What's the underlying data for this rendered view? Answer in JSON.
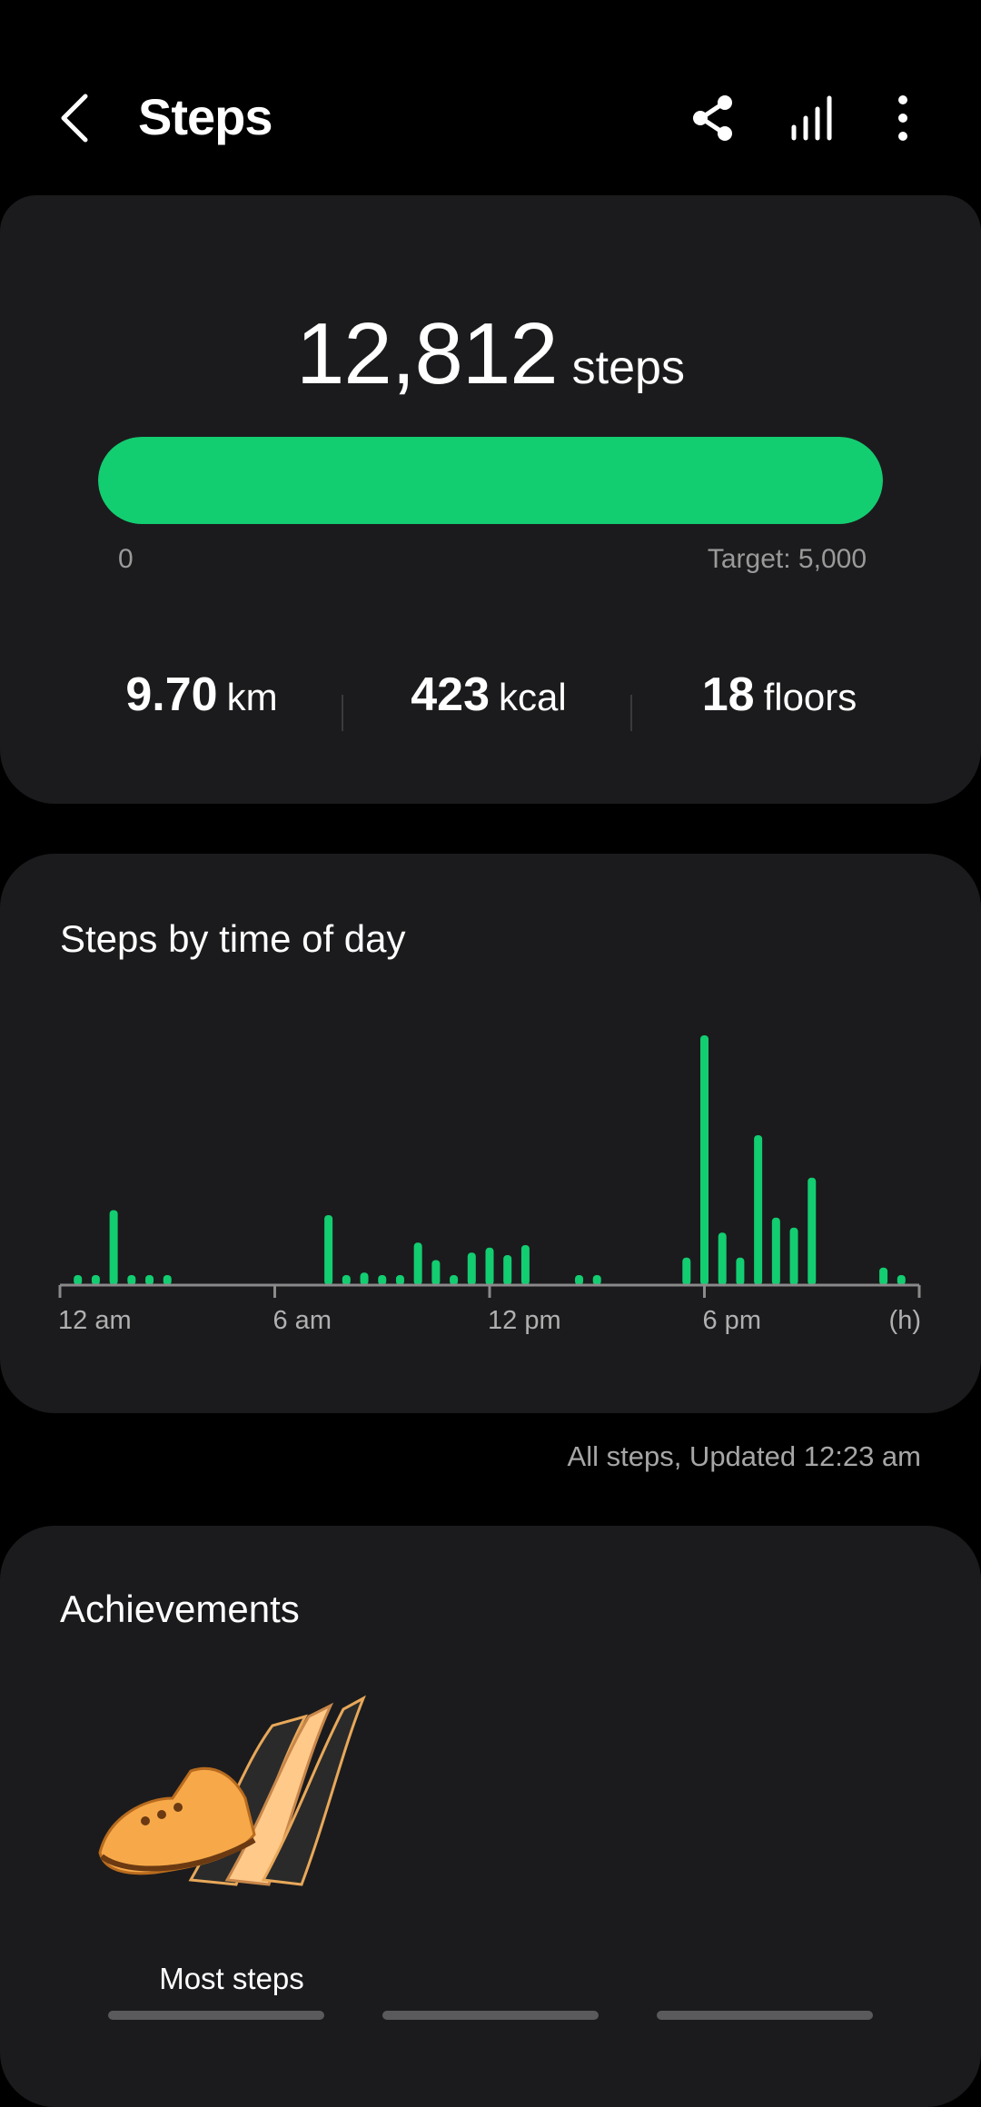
{
  "header": {
    "title": "Steps",
    "icons": [
      "chevron-left-icon",
      "share-icon",
      "trends-icon",
      "more-vert-icon"
    ]
  },
  "summary": {
    "steps": "12,812",
    "steps_unit": "steps",
    "progress": {
      "min_label": "0",
      "target_label": "Target: 5,000",
      "fill_fraction": 1.0
    },
    "metrics": [
      {
        "value": "9.70",
        "unit": "km"
      },
      {
        "value": "423",
        "unit": "kcal"
      },
      {
        "value": "18",
        "unit": "floors"
      }
    ]
  },
  "chart": {
    "title": "Steps by time of day",
    "footer": "All steps, Updated 12:23 am"
  },
  "chart_data": {
    "type": "bar",
    "xlabel": "",
    "ylabel": "",
    "x_ticks": [
      "12 am",
      "6 am",
      "12 pm",
      "6 pm",
      "(h)"
    ],
    "x": [
      0.5,
      1.0,
      1.5,
      2.0,
      2.5,
      3.0,
      7.5,
      8.0,
      8.5,
      9.0,
      9.5,
      10.0,
      10.5,
      11.0,
      11.5,
      12.0,
      12.5,
      13.0,
      14.5,
      15.0,
      17.5,
      18.0,
      18.5,
      19.0,
      19.5,
      20.0,
      20.5,
      21.0,
      23.0,
      23.5
    ],
    "values": [
      4,
      4,
      30,
      4,
      4,
      4,
      28,
      4,
      5,
      4,
      4,
      17,
      10,
      4,
      13,
      15,
      12,
      16,
      4,
      4,
      11,
      100,
      21,
      11,
      60,
      27,
      23,
      43,
      7,
      4
    ],
    "colors": {
      "bar": "#13cd71",
      "axis": "#8a8a8a"
    }
  },
  "achievements": {
    "title": "Achievements",
    "items": [
      {
        "label": "Most steps",
        "icon": "sneaker-badge-icon"
      }
    ]
  },
  "page_indicator": {
    "count": 3
  },
  "colors": {
    "accent": "#13cd71",
    "card": "#1b1b1d",
    "background": "#000000"
  }
}
